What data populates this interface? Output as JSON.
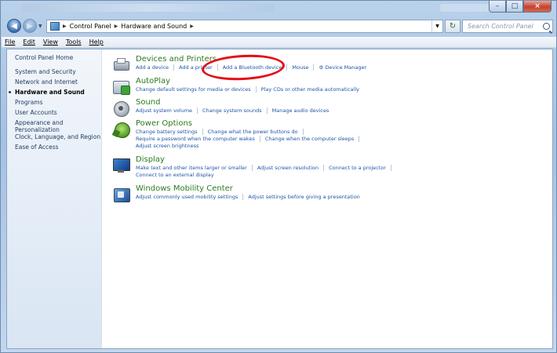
{
  "window": {
    "controls": {
      "minimize_icon": "minimize-icon",
      "maximize_icon": "maximize-icon",
      "close_icon": "close-icon"
    }
  },
  "address_bar": {
    "breadcrumb": [
      "Control Panel",
      "Hardware and Sound"
    ],
    "search_placeholder": "Search Control Panel"
  },
  "menu": [
    "File",
    "Edit",
    "View",
    "Tools",
    "Help"
  ],
  "sidebar": {
    "home": "Control Panel Home",
    "items": [
      {
        "label": "System and Security"
      },
      {
        "label": "Network and Internet"
      },
      {
        "label": "Hardware and Sound",
        "current": true
      },
      {
        "label": "Programs"
      },
      {
        "label": "User Accounts"
      },
      {
        "label": "Appearance and Personalization"
      },
      {
        "label": "Clock, Language, and Region"
      },
      {
        "label": "Ease of Access"
      }
    ]
  },
  "categories": [
    {
      "title": "Devices and Printers",
      "icon": "printer-icon",
      "links": [
        "Add a device",
        "Add a printer",
        "Add a Bluetooth device",
        "Mouse",
        "Device Manager"
      ]
    },
    {
      "title": "AutoPlay",
      "icon": "autoplay-icon",
      "links": [
        "Change default settings for media or devices",
        "Play CDs or other media automatically"
      ]
    },
    {
      "title": "Sound",
      "icon": "speaker-icon",
      "links": [
        "Adjust system volume",
        "Change system sounds",
        "Manage audio devices"
      ]
    },
    {
      "title": "Power Options",
      "icon": "power-icon",
      "links": [
        "Change battery settings",
        "Change what the power buttons do",
        "Require a password when the computer wakes",
        "Change when the computer sleeps",
        "Adjust screen brightness"
      ]
    },
    {
      "title": "Display",
      "icon": "monitor-icon",
      "links": [
        "Make text and other items larger or smaller",
        "Adjust screen resolution",
        "Connect to a projector",
        "Connect to an external display"
      ]
    },
    {
      "title": "Windows Mobility Center",
      "icon": "mobility-icon",
      "links": [
        "Adjust commonly used mobility settings",
        "Adjust settings before giving a presentation"
      ]
    }
  ],
  "annotation": {
    "color": "#e40d14",
    "target": "Add a Bluetooth device"
  }
}
